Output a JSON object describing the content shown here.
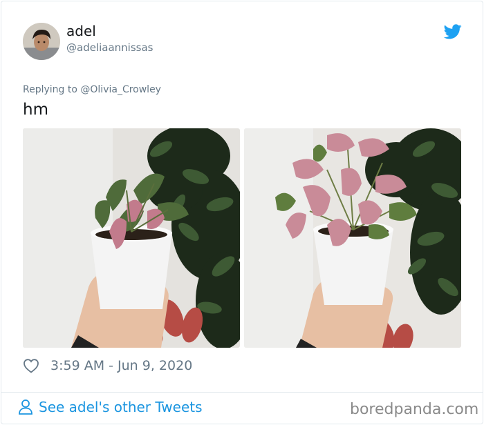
{
  "tweet": {
    "display_name": "adel",
    "handle": "@adeliaannissas",
    "reply_prefix": "Replying to",
    "reply_to": "@Olivia_Crowley",
    "text": "hm",
    "timestamp": "3:59 AM - Jun 9, 2020",
    "brand_icon": "twitter-bird-icon",
    "like_icon": "heart-outline-icon"
  },
  "footer": {
    "see_other_tweets": "See adel's other Tweets",
    "user_icon": "person-outline-icon"
  },
  "watermark": "boredpanda.com",
  "colors": {
    "twitter_blue": "#1da1f2",
    "link_blue": "#1b95e0",
    "secondary_text": "#657786",
    "primary_text": "#14171a",
    "border": "#e1e8ed"
  }
}
